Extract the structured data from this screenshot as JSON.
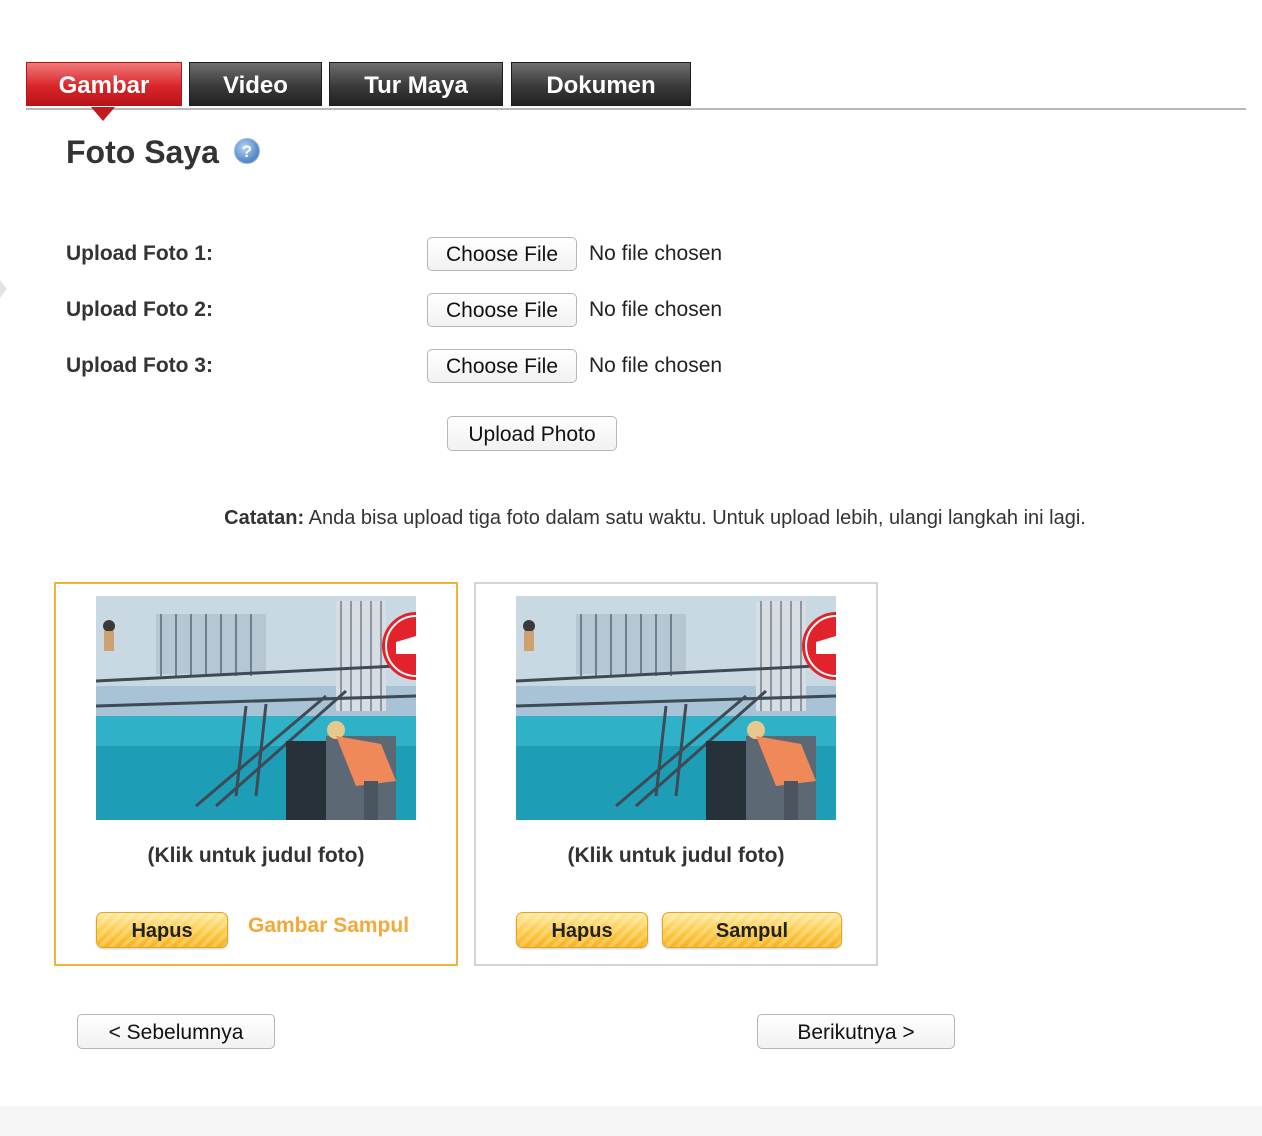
{
  "tabs": [
    {
      "label": "Gambar",
      "active": true
    },
    {
      "label": "Video",
      "active": false
    },
    {
      "label": "Tur Maya",
      "active": false
    },
    {
      "label": "Dokumen",
      "active": false
    }
  ],
  "page_title": "Foto Saya",
  "help_icon": "question-mark-icon",
  "uploads": [
    {
      "label": "Upload Foto 1:",
      "button": "Choose File",
      "status": "No file chosen"
    },
    {
      "label": "Upload Foto 2:",
      "button": "Choose File",
      "status": "No file chosen"
    },
    {
      "label": "Upload Foto 3:",
      "button": "Choose File",
      "status": "No file chosen"
    }
  ],
  "upload_button": "Upload Photo",
  "note": {
    "prefix": "Catatan:",
    "text": " Anda bisa upload tiga foto dalam satu waktu. Untuk upload lebih, ulangi langkah ini lagi."
  },
  "photos": [
    {
      "caption": "(Klik untuk judul foto)",
      "delete_label": "Hapus",
      "cover_label": "Gambar Sampul",
      "is_cover": true
    },
    {
      "caption": "(Klik untuk judul foto)",
      "delete_label": "Hapus",
      "set_cover_label": "Sampul",
      "is_cover": false
    }
  ],
  "nav": {
    "prev": "< Sebelumnya",
    "next": "Berikutnya >"
  },
  "colors": {
    "active_tab": "#d8262b",
    "inactive_tab": "#3a3a3a",
    "cover_border": "#f3b23c",
    "cover_text": "#f3a838",
    "button_yellow": "#fccb47"
  }
}
